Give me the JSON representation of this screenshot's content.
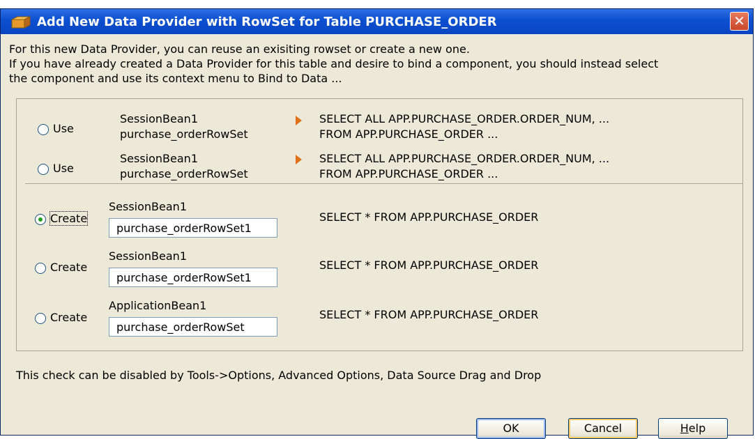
{
  "window": {
    "title": "Add New Data Provider with RowSet for Table PURCHASE_ORDER",
    "close_glyph": "✕"
  },
  "intro": {
    "line1": "For this new Data Provider, you can reuse an exisiting rowset or create a new one.",
    "line2": "If you have already created a Data Provider for this table and desire to bind a component, you should instead select",
    "line3": "the component and use its context menu to Bind to Data ..."
  },
  "use_options": [
    {
      "radio_label": "Use",
      "bean": "SessionBean1",
      "rowset": "purchase_orderRowSet",
      "query_line1": "SELECT ALL APP.PURCHASE_ORDER.ORDER_NUM, ...",
      "query_line2": "FROM APP.PURCHASE_ORDER ...",
      "selected": false
    },
    {
      "radio_label": "Use",
      "bean": "SessionBean1",
      "rowset": "purchase_orderRowSet",
      "query_line1": "SELECT ALL APP.PURCHASE_ORDER.ORDER_NUM, ...",
      "query_line2": "FROM APP.PURCHASE_ORDER ...",
      "selected": false
    }
  ],
  "create_options": [
    {
      "radio_label": "Create",
      "bean": "SessionBean1",
      "rowset_value": "purchase_orderRowSet1",
      "query": "SELECT * FROM APP.PURCHASE_ORDER",
      "selected": true
    },
    {
      "radio_label": "Create",
      "bean": "SessionBean1",
      "rowset_value": "purchase_orderRowSet1",
      "query": "SELECT * FROM APP.PURCHASE_ORDER",
      "selected": false
    },
    {
      "radio_label": "Create",
      "bean": "ApplicationBean1",
      "rowset_value": "purchase_orderRowSet",
      "query": "SELECT * FROM APP.PURCHASE_ORDER",
      "selected": false
    }
  ],
  "footnote": "This check can be disabled by Tools->Options, Advanced Options, Data Source Drag and Drop",
  "buttons": {
    "ok": "OK",
    "cancel": "Cancel",
    "help_mnemonic": "H",
    "help_rest": "elp"
  },
  "colors": {
    "title_bar": "#0b4fd0",
    "dialog_bg": "#ece9d8",
    "expand_arrow": "#e0701a",
    "radio_selected": "#21a121"
  }
}
